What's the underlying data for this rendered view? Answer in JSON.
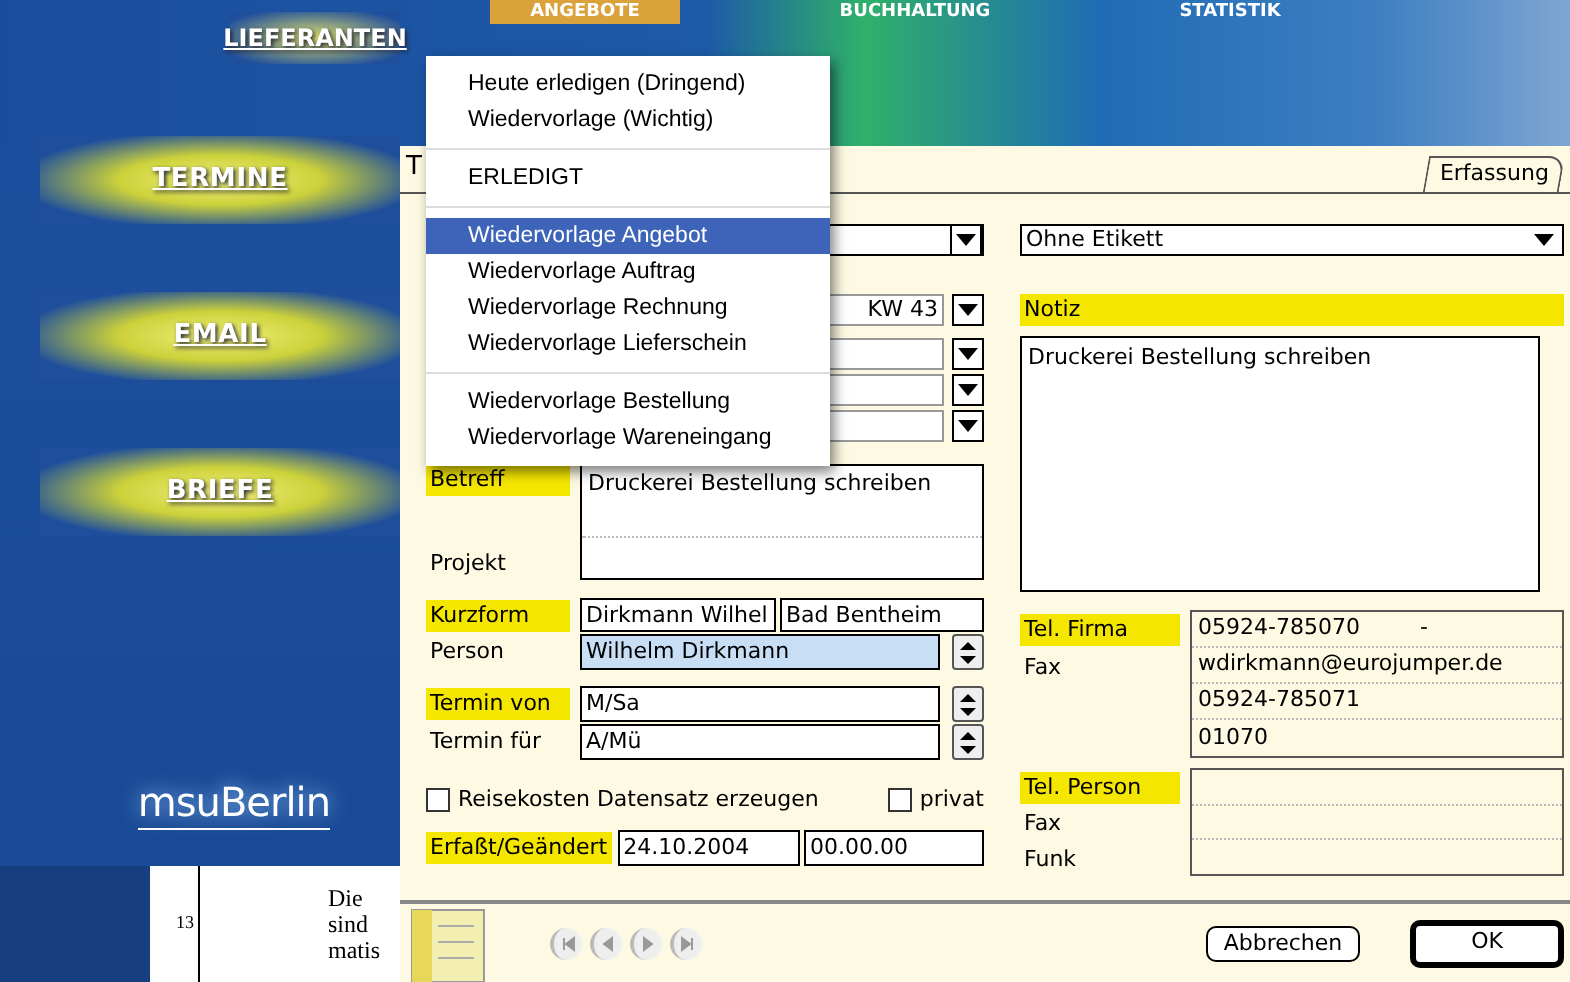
{
  "banner": {
    "nav": [
      {
        "label": "LIEFERANTEN"
      },
      {
        "label": "ANGEBOTE"
      },
      {
        "label": "BUCHHALTUNG"
      },
      {
        "label": "STATISTIK"
      }
    ]
  },
  "sidebar": {
    "items": [
      {
        "label": "TERMINE"
      },
      {
        "label": "EMAIL"
      },
      {
        "label": "BRIEFE"
      }
    ],
    "logo": "msuBerlin"
  },
  "background_document": {
    "line_number": "13",
    "words": [
      "Die",
      "sind",
      "matis"
    ]
  },
  "window": {
    "title": "T",
    "tabs": [
      {
        "label": "Erfassung",
        "selected": true
      }
    ]
  },
  "popup_menu": {
    "groups": [
      [
        {
          "label": "Heute erledigen (Dringend)",
          "selected": false
        },
        {
          "label": "Wiedervorlage (Wichtig)",
          "selected": false
        }
      ],
      [
        {
          "label": "ERLEDIGT",
          "selected": false
        }
      ],
      [
        {
          "label": "Wiedervorlage Angebot",
          "selected": true
        },
        {
          "label": "Wiedervorlage Auftrag",
          "selected": false
        },
        {
          "label": "Wiedervorlage Rechnung",
          "selected": false
        },
        {
          "label": "Wiedervorlage Lieferschein",
          "selected": false
        }
      ],
      [
        {
          "label": "Wiedervorlage Bestellung",
          "selected": false
        },
        {
          "label": "Wiedervorlage Wareneingang",
          "selected": false
        }
      ]
    ]
  },
  "form": {
    "etikett": "Ohne Etikett",
    "week": "KW 43",
    "notiz_label": {
      "text": "Notiz",
      "highlighted": true
    },
    "notiz": "Druckerei Bestellung schreiben",
    "betreff_label": {
      "text": "Betreff",
      "highlighted": true
    },
    "betreff": "Druckerei Bestellung schreiben",
    "projekt_label": {
      "text": "Projekt",
      "highlighted": false
    },
    "kurzform_label": {
      "text": "Kurzform",
      "highlighted": true
    },
    "kurzform": "Dirkmann Wilhel",
    "ort": "Bad Bentheim",
    "person_label": {
      "text": "Person",
      "highlighted": false
    },
    "person": "Wilhelm Dirkmann",
    "termin_von_label": {
      "text": "Termin von",
      "highlighted": true
    },
    "termin_von": "M/Sa",
    "termin_fuer_label": {
      "text": "Termin für",
      "highlighted": false
    },
    "termin_fuer": "A/Mü",
    "checkboxes": [
      {
        "label": "Reisekosten Datensatz erzeugen",
        "checked": false
      },
      {
        "label": "privat",
        "checked": false
      }
    ],
    "erfasst_label": {
      "text": "Erfaßt/Geändert",
      "highlighted": true
    },
    "erfasst_date": "24.10.2004",
    "erfasst_time": "00.00.00",
    "company_contact": {
      "labels": [
        {
          "text": "Tel. Firma",
          "highlighted": true
        },
        {
          "text": "Fax",
          "highlighted": false
        }
      ],
      "rows": [
        "05924-785070",
        "wdirkmann@eurojumper.de",
        "05924-785071",
        "01070"
      ],
      "row_suffix": "-"
    },
    "person_contact": {
      "labels": [
        {
          "text": "Tel. Person",
          "highlighted": true
        },
        {
          "text": "Fax",
          "highlighted": false
        },
        {
          "text": "Funk",
          "highlighted": false
        }
      ]
    },
    "buttons": [
      {
        "label": "Abbrechen",
        "default": false
      },
      {
        "label": "OK",
        "default": true
      }
    ]
  }
}
